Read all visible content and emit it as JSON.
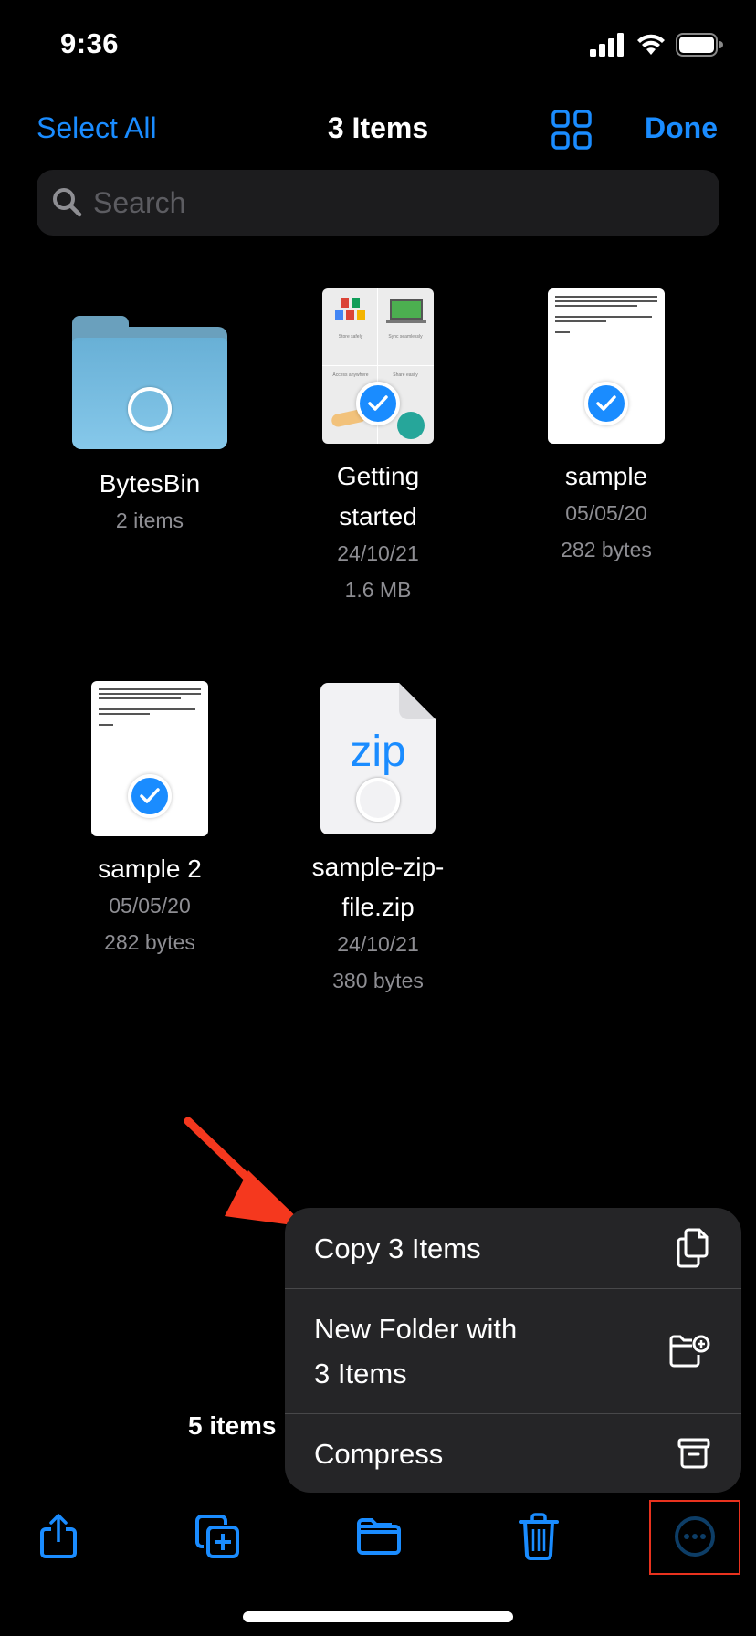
{
  "status_bar": {
    "time": "9:36"
  },
  "nav": {
    "left_button": "Select All",
    "title": "3 Items",
    "view_toggle_icon": "grid-icon",
    "right_button": "Done"
  },
  "search": {
    "placeholder": "Search",
    "value": ""
  },
  "items": [
    {
      "name": "BytesBin",
      "meta1": "2 items",
      "meta2": "",
      "type": "folder",
      "selected": false
    },
    {
      "name": "Getting started",
      "meta1": "24/10/21",
      "meta2": "1.6 MB",
      "type": "pdf",
      "selected": true
    },
    {
      "name": "sample",
      "meta1": "05/05/20",
      "meta2": "282 bytes",
      "type": "text",
      "selected": true
    },
    {
      "name": "sample 2",
      "meta1": "05/05/20",
      "meta2": "282 bytes",
      "type": "text",
      "selected": true
    },
    {
      "name": "sample-zip-file.zip",
      "meta1": "24/10/21",
      "meta2": "380 bytes",
      "type": "zip",
      "selected": false
    }
  ],
  "thumb_text": {
    "zip_label": "zip",
    "gs_panels": [
      "Store safely",
      "Sync seamlessly",
      "Access anywhere",
      "Share easily"
    ]
  },
  "name_lines": {
    "getting_started": [
      "Getting",
      "started"
    ],
    "zip": [
      "sample-zip-",
      "file.zip"
    ]
  },
  "summary": "5 items",
  "context_menu": {
    "items": [
      {
        "label": "Copy 3 Items",
        "icon": "copy-documents-icon"
      },
      {
        "label_line1": "New Folder with",
        "label_line2": "3 Items",
        "icon": "folder-plus-icon"
      },
      {
        "label": "Compress",
        "icon": "archive-box-icon"
      }
    ]
  },
  "toolbar": {
    "buttons": [
      {
        "name": "share",
        "icon": "share-icon"
      },
      {
        "name": "duplicate",
        "icon": "duplicate-icon"
      },
      {
        "name": "move",
        "icon": "folder-icon"
      },
      {
        "name": "delete",
        "icon": "trash-icon"
      },
      {
        "name": "more",
        "icon": "more-ellipsis-icon"
      }
    ]
  },
  "colors": {
    "accent": "#1a8cff",
    "background": "#000000",
    "secondary_text": "#8e8e93",
    "menu_bg": "#252527",
    "annotation_red": "#e8321e"
  }
}
